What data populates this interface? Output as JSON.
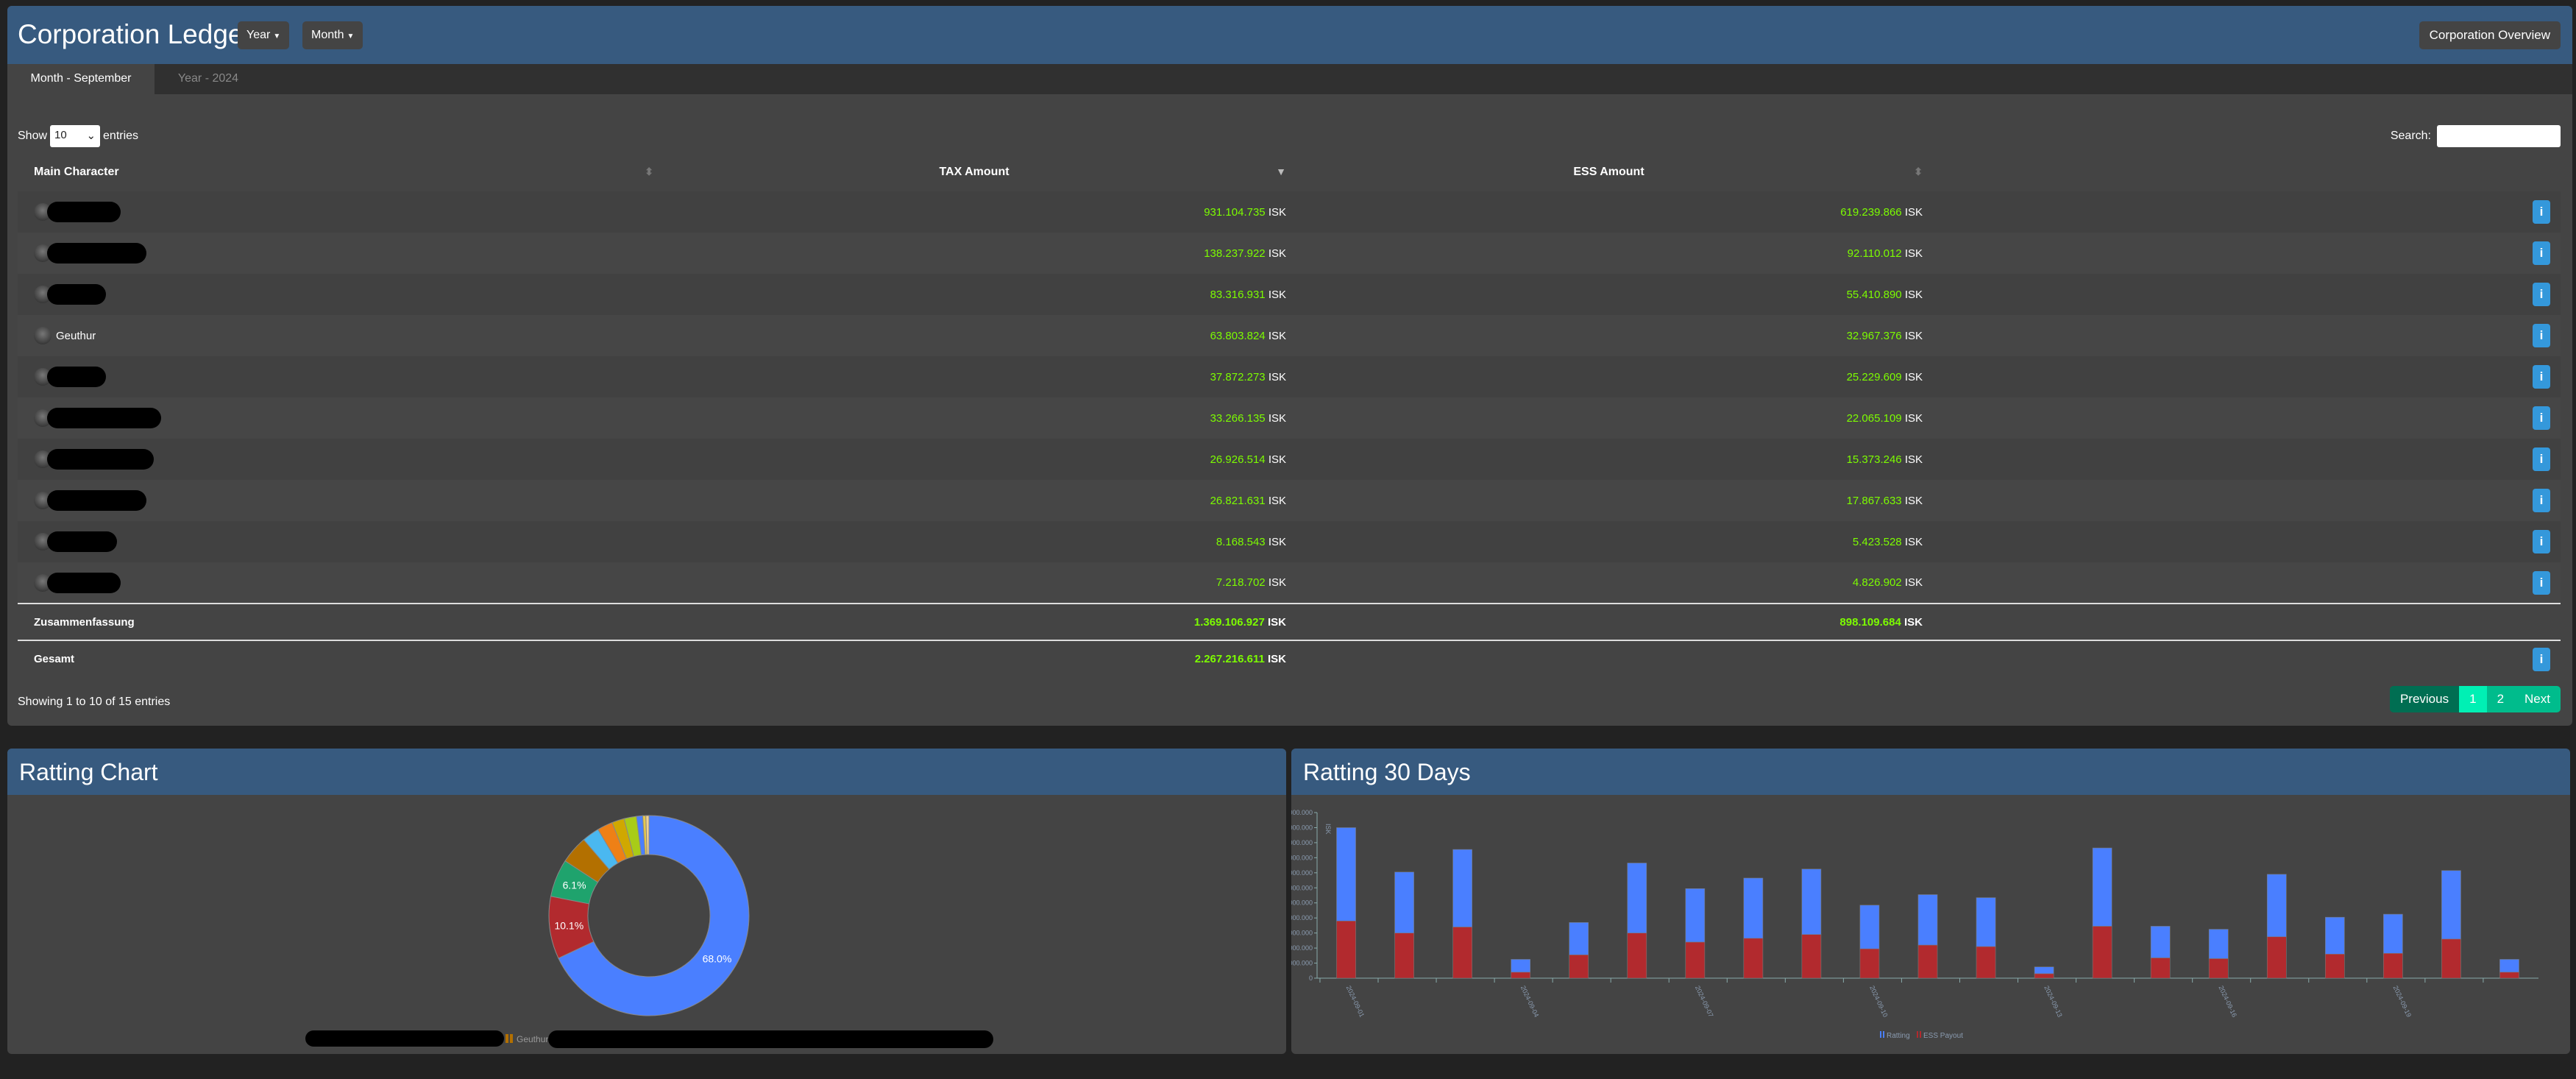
{
  "header": {
    "title": "Corporation Ledger",
    "year_label": "Year",
    "month_label": "Month",
    "overview_button": "Corporation Overview"
  },
  "tabs": [
    {
      "label": "Month - September",
      "active": true
    },
    {
      "label": "Year - 2024",
      "active": false
    }
  ],
  "table_controls": {
    "show": "Show",
    "entries_value": "10",
    "entries": "entries",
    "search_label": "Search:",
    "search_value": ""
  },
  "columns": [
    "Main Character",
    "TAX Amount",
    "ESS Amount"
  ],
  "currency": "ISK",
  "rows": [
    {
      "name": "",
      "tax": "931.104.735",
      "ess": "619.239.866"
    },
    {
      "name": "",
      "tax": "138.237.922",
      "ess": "92.110.012"
    },
    {
      "name": "",
      "tax": "83.316.931",
      "ess": "55.410.890"
    },
    {
      "name": "Geuthur",
      "tax": "63.803.824",
      "ess": "32.967.376"
    },
    {
      "name": "",
      "tax": "37.872.273",
      "ess": "25.229.609"
    },
    {
      "name": "",
      "tax": "33.266.135",
      "ess": "22.065.109"
    },
    {
      "name": "",
      "tax": "26.926.514",
      "ess": "15.373.246"
    },
    {
      "name": "",
      "tax": "26.821.631",
      "ess": "17.867.633"
    },
    {
      "name": "",
      "tax": "8.168.543",
      "ess": "5.423.528"
    },
    {
      "name": "",
      "tax": "7.218.702",
      "ess": "4.826.902"
    }
  ],
  "info_label": "i",
  "summary": {
    "label": "Zusammenfassung",
    "tax": "1.369.106.927",
    "ess": "898.109.684"
  },
  "total": {
    "label": "Gesamt",
    "tax": "2.267.216.611"
  },
  "footer": {
    "showing": "Showing 1 to 10 of 15 entries",
    "previous": "Previous",
    "pages": [
      "1",
      "2"
    ],
    "active_page": "1",
    "next": "Next"
  },
  "colors": {
    "header": "#375a7f",
    "positive": "#7cfc00",
    "info": "#3498db",
    "pager": "#00bc8c"
  },
  "chart_data": [
    {
      "type": "pie",
      "title": "Ratting Chart",
      "donut": true,
      "slices": [
        {
          "value": 68.0,
          "label": "68.0%",
          "color": "#4a7fff"
        },
        {
          "value": 10.1,
          "label": "10.1%",
          "color": "#b22a2e"
        },
        {
          "value": 6.1,
          "label": "6.1%",
          "color": "#1fa36d"
        },
        {
          "value": 4.5,
          "color": "#b37000"
        },
        {
          "value": 2.8,
          "color": "#4ab8f0"
        },
        {
          "value": 2.5,
          "color": "#ee8016"
        },
        {
          "value": 2.0,
          "color": "#d0a800"
        },
        {
          "value": 2.0,
          "color": "#a8cc18"
        },
        {
          "value": 1.0,
          "color": "#4a7fff"
        },
        {
          "value": 0.5,
          "color": "#e6c84c"
        },
        {
          "value": 0.5,
          "color": "#f0d090"
        }
      ],
      "legend": [
        "Geuthur"
      ]
    },
    {
      "type": "bar",
      "stacked": true,
      "title": "Ratting 30 Days",
      "ylabel": "ISK",
      "ylim": [
        0,
        220000000
      ],
      "yticks": [
        "0",
        "20.000.000",
        "40.000.000",
        "60.000.000",
        "80.000.000",
        "100.000.000",
        "120.000.000",
        "140.000.000",
        "160.000.000",
        "180.000.000",
        "200.000.000",
        "220.000.000"
      ],
      "categories": [
        "2024-09-01",
        "2024-09-02",
        "2024-09-03",
        "2024-09-04",
        "2024-09-05",
        "2024-09-06",
        "2024-09-07",
        "2024-09-08",
        "2024-09-09",
        "2024-09-10",
        "2024-09-11",
        "2024-09-12",
        "2024-09-13",
        "2024-09-14",
        "2024-09-15",
        "2024-09-16",
        "2024-09-17",
        "2024-09-18",
        "2024-09-19",
        "2024-09-20",
        "2024-09-21"
      ],
      "xtick_labels": [
        "2024-09-01",
        "2024-09-04",
        "2024-09-07",
        "2024-09-10",
        "2024-09-13",
        "2024-09-16",
        "2024-09-19"
      ],
      "series": [
        {
          "name": "ESS Payout",
          "color": "#b22a2e",
          "values": [
            76000000,
            60000000,
            68000000,
            8000000,
            31000000,
            60000000,
            48000000,
            53000000,
            58000000,
            39000000,
            44000000,
            42000000,
            6000000,
            69000000,
            27000000,
            26000000,
            55000000,
            32000000,
            33000000,
            52000000,
            8000000
          ]
        },
        {
          "name": "Ratting",
          "color": "#4a7fff",
          "values": [
            124000000,
            81000000,
            103000000,
            17000000,
            43000000,
            93000000,
            71000000,
            80000000,
            87000000,
            58000000,
            67000000,
            65000000,
            9000000,
            104000000,
            42000000,
            39000000,
            83000000,
            49000000,
            52000000,
            91000000,
            17000000
          ]
        }
      ],
      "legend": [
        "Ratting",
        "ESS Payout"
      ],
      "legend_position": "bottom"
    }
  ]
}
